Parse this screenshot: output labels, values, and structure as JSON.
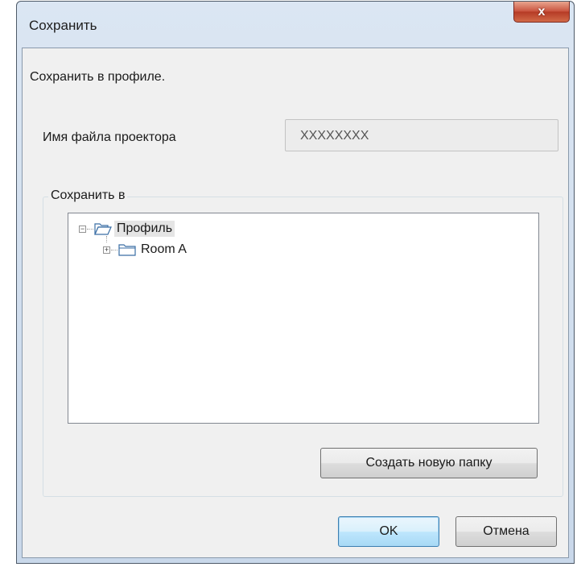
{
  "window": {
    "title": "Сохранить",
    "close_label": "x"
  },
  "instruction": "Сохранить в профиле.",
  "projector_file": {
    "label": "Имя файла проектора",
    "value": "XXXXXXXX"
  },
  "save_in": {
    "group_label": "Сохранить в",
    "tree": [
      {
        "label": "Профиль",
        "expanded": true,
        "selected": true,
        "icon": "open-folder-icon"
      },
      {
        "label": "Room A",
        "expanded": false,
        "selected": false,
        "icon": "folder-icon"
      }
    ],
    "new_folder_label": "Создать новую папку"
  },
  "buttons": {
    "ok_label": "OK",
    "cancel_label": "Отмена"
  },
  "colors": {
    "close_button": "#c9513c",
    "default_button": "#bee6fd",
    "dialog_bg": "#f0f0f0"
  }
}
